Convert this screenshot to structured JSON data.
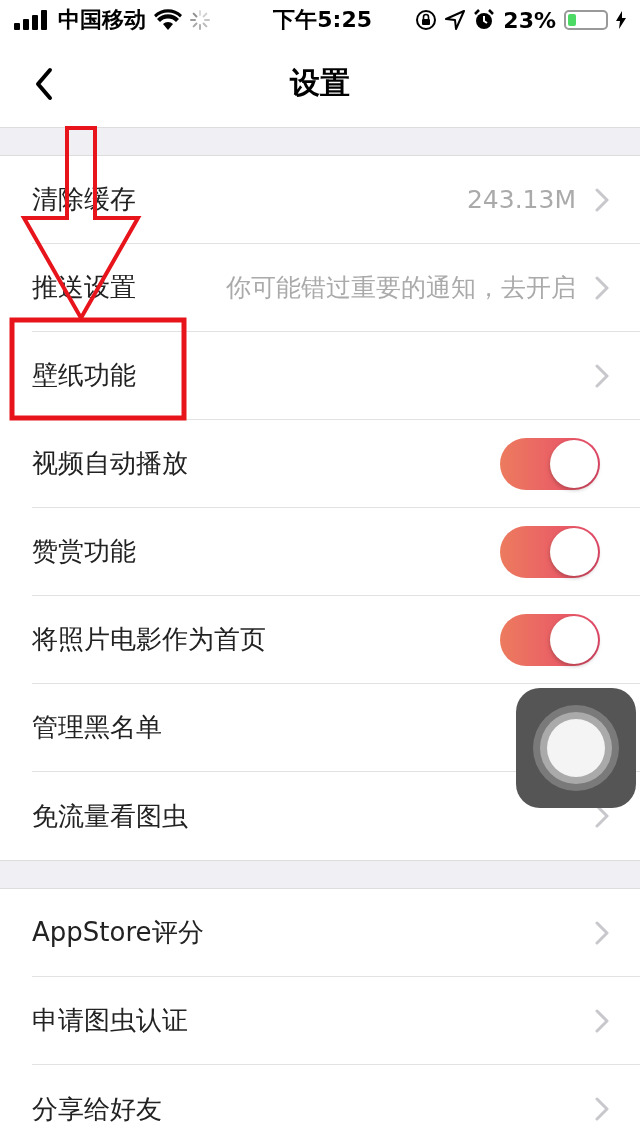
{
  "status_bar": {
    "carrier": "中国移动",
    "time": "下午5:25",
    "battery_text": "23%"
  },
  "nav": {
    "title": "设置"
  },
  "sections": [
    {
      "rows": [
        {
          "kind": "link",
          "label": "清除缓存",
          "value": "243.13M",
          "chevron": true
        },
        {
          "kind": "link",
          "label": "推送设置",
          "value": "你可能错过重要的通知，去开启",
          "chevron": true
        },
        {
          "kind": "link",
          "label": "壁纸功能",
          "chevron": true
        },
        {
          "kind": "toggle",
          "label": "视频自动播放",
          "on": true
        },
        {
          "kind": "toggle",
          "label": "赞赏功能",
          "on": true
        },
        {
          "kind": "toggle",
          "label": "将照片电影作为首页",
          "on": true
        },
        {
          "kind": "link",
          "label": "管理黑名单",
          "chevron": false
        },
        {
          "kind": "link",
          "label": "免流量看图虫",
          "chevron": true
        }
      ]
    },
    {
      "rows": [
        {
          "kind": "link",
          "label": "AppStore评分",
          "chevron": true
        },
        {
          "kind": "link",
          "label": "申请图虫认证",
          "chevron": true
        },
        {
          "kind": "link",
          "label": "分享给好友",
          "chevron": true
        }
      ]
    }
  ]
}
